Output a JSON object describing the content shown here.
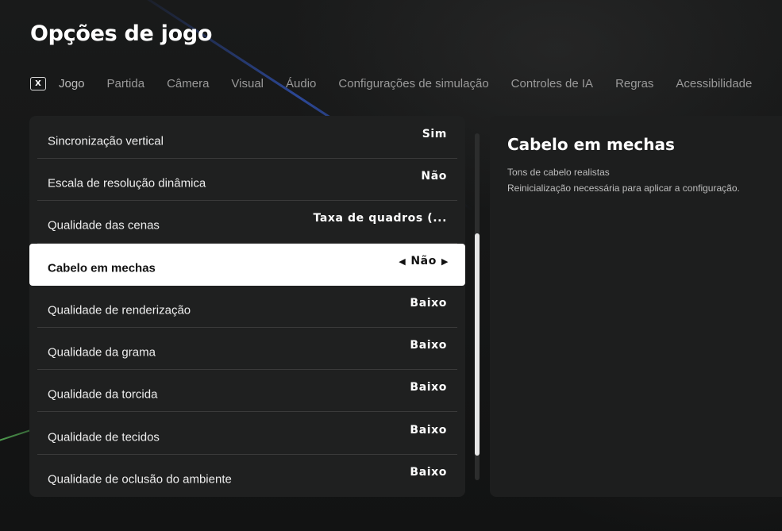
{
  "page_title": "Opções de jogo",
  "tabs": {
    "key_hint": "X",
    "items": [
      {
        "label": "Jogo"
      },
      {
        "label": "Partida"
      },
      {
        "label": "Câmera"
      },
      {
        "label": "Visual"
      },
      {
        "label": "Áudio"
      },
      {
        "label": "Configurações de simulação"
      },
      {
        "label": "Controles de IA"
      },
      {
        "label": "Regras"
      },
      {
        "label": "Acessibilidade"
      }
    ]
  },
  "settings": [
    {
      "label": "Sincronização vertical",
      "value": "Sim"
    },
    {
      "label": "Escala de resolução dinâmica",
      "value": "Não"
    },
    {
      "label": "Qualidade das cenas",
      "value": "Taxa de quadros (..."
    },
    {
      "label": "Cabelo em mechas",
      "value": "Não",
      "selected": true
    },
    {
      "label": "Qualidade de renderização",
      "value": "Baixo"
    },
    {
      "label": "Qualidade da grama",
      "value": "Baixo"
    },
    {
      "label": "Qualidade da torcida",
      "value": "Baixo"
    },
    {
      "label": "Qualidade de tecidos",
      "value": "Baixo"
    },
    {
      "label": "Qualidade de oclusão do ambiente",
      "value": "Baixo"
    }
  ],
  "selector_arrows": {
    "left": "◀",
    "right": "▶"
  },
  "detail": {
    "title": "Cabelo em mechas",
    "description_lines": [
      "Tons de cabelo realistas",
      "Reinicialização necessária para aplicar a configuração."
    ]
  },
  "colors": {
    "background": "#161717",
    "panel": "#1f2020",
    "selected_row": "#ffffff",
    "tab_text": "#9a9a9a",
    "scroll_thumb": "#e6e6e6"
  }
}
